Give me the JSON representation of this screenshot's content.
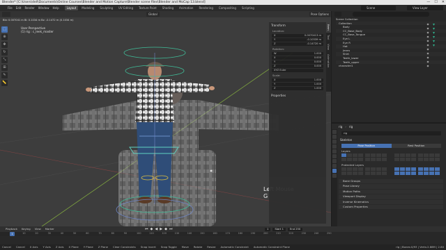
{
  "window": {
    "title": "Blender* [C:\\Users\\dell\\Documents\\Online Courses\\Blender and Motion Capture\\Blender scene files\\Blender and MoCap 13.blend]",
    "controls": [
      "—",
      "☐",
      "✕"
    ]
  },
  "menu": {
    "items": [
      "File",
      "Edit",
      "Render",
      "Window",
      "Help"
    ],
    "workspaces": [
      "Layout",
      "Modeling",
      "Sculpting",
      "UV Editing",
      "Texture Paint",
      "Shading",
      "Animation",
      "Rendering",
      "Compositing",
      "Scripting"
    ],
    "active_workspace": "Layout",
    "scene": "Scene",
    "view_layer": "View Layer"
  },
  "viewport": {
    "mode": "Pose Mode",
    "shading": "Global",
    "info_line": "Bla: 0.007041 m  Bl: 0.1034 m  Bz: -0.1472 m  (0.1034 m)",
    "view_name": "User Perspective",
    "object_name": "(1) rig : c_leek_master",
    "hint_line1": "Left Mouse",
    "hint_line2": "G",
    "pose_options": "Pose Options"
  },
  "tools": [
    {
      "name": "select-tool",
      "glyph": "⬚"
    },
    {
      "name": "cursor-tool",
      "glyph": "⊕"
    },
    {
      "name": "move-tool",
      "glyph": "✥"
    },
    {
      "name": "rotate-tool",
      "glyph": "↻"
    },
    {
      "name": "scale-tool",
      "glyph": "⤡"
    },
    {
      "name": "transform-tool",
      "glyph": "⊞"
    },
    {
      "name": "annotate-tool",
      "glyph": "✎"
    },
    {
      "name": "measure-tool",
      "glyph": "📏"
    }
  ],
  "npanel": {
    "transform_title": "Transform",
    "location_label": "Location:",
    "location": [
      [
        "X",
        "0.0070413 m"
      ],
      [
        "Y",
        "-0.10339 m"
      ],
      [
        "Z",
        "-0.14720 m"
      ]
    ],
    "rotation_label": "Rotation:",
    "rotation": [
      [
        "W",
        "1.000"
      ],
      [
        "X",
        "0.000"
      ],
      [
        "Y",
        "0.000"
      ],
      [
        "Z",
        "0.000"
      ]
    ],
    "rotation_mode": "XYZ Euler",
    "scale_label": "Scale:",
    "scale": [
      [
        "X",
        "1.000"
      ],
      [
        "Y",
        "1.000"
      ],
      [
        "Z",
        "1.000"
      ]
    ],
    "properties_title": "Properties",
    "tabs": [
      "Item",
      "Tool",
      "View",
      "Animation"
    ]
  },
  "outliner": {
    "root": "Scene Collection",
    "items": [
      "Collection",
      "Body",
      "CC_Base_Body",
      "CC_Base_Tongue",
      "Eye L",
      "Eye R",
      "Hat",
      "Jeans",
      "Shirt",
      "Teeth_lower",
      "Teeth_upper",
      "character1"
    ]
  },
  "properties": {
    "object": "rig",
    "data": "rig",
    "skeleton_title": "Skeleton",
    "pose_position": "Pose Position",
    "rest_position": "Rest Position",
    "layers_label": "Layers",
    "protected_layers_label": "Protected Layers",
    "panels": [
      "Bone Groups",
      "Pose Library",
      "Motion Paths",
      "Viewport Display",
      "Inverse Kinematics",
      "Custom Properties"
    ]
  },
  "timeline": {
    "menu": [
      "Playback",
      "Keying",
      "View",
      "Marker"
    ],
    "current_frame": "1",
    "start_label": "Start",
    "start": "1",
    "end_label": "End",
    "end": "250",
    "ticks": [
      "1",
      "10",
      "20",
      "30",
      "40",
      "50",
      "60",
      "70",
      "80",
      "90",
      "100",
      "110",
      "120",
      "130",
      "140",
      "150",
      "160",
      "170",
      "180",
      "190",
      "200",
      "210",
      "220",
      "230",
      "240",
      "250"
    ]
  },
  "status": {
    "items": [
      "Cancel",
      "Cancel",
      "X Axis",
      "Y Axis",
      "Z Axis",
      "X Plane",
      "Y Plane",
      "Z Plane",
      "Clear Constraints",
      "Snap Invert",
      "Snap Toggle",
      "Move",
      "Rotate",
      "Resize",
      "Automatic Constraint",
      "Automatic Constraint Plane"
    ],
    "right": "rig | Bones:0/93 | Verts:2.88M | 2.80"
  }
}
